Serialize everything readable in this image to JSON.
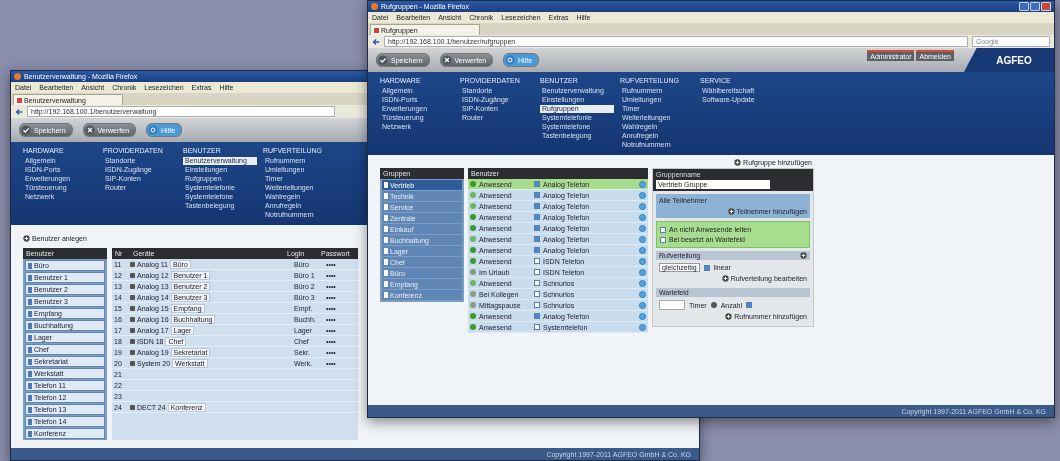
{
  "windows": [
    {
      "title": "Benutzerverwaltung - Mozilla Firefox",
      "menu": [
        "Datei",
        "Bearbeiten",
        "Ansicht",
        "Chronik",
        "Lesezeichen",
        "Extras",
        "Hilfe"
      ],
      "tab": "Benutzerverwaltung",
      "url": "http://192.168.100.1/benutzerverwaltung",
      "buttons": [
        {
          "kind": "save",
          "label": "Speichern"
        },
        {
          "kind": "discard",
          "label": "Verwerfen"
        },
        {
          "kind": "help",
          "label": "Hilfe"
        }
      ],
      "nav": [
        {
          "heading": "HARDWARE",
          "items": [
            {
              "label": "Allgemein",
              "selected": false
            },
            {
              "label": "ISDN-Ports",
              "selected": false
            },
            {
              "label": "Erweiterungen",
              "selected": false
            },
            {
              "label": "Türsteuerung",
              "selected": false
            },
            {
              "label": "Netzwerk",
              "selected": false
            }
          ]
        },
        {
          "heading": "PROVIDERDATEN",
          "items": [
            {
              "label": "Standorte",
              "selected": false
            },
            {
              "label": "ISDN-Zugänge",
              "selected": false
            },
            {
              "label": "SIP-Konten",
              "selected": false
            },
            {
              "label": "Router",
              "selected": false
            }
          ]
        },
        {
          "heading": "BENUTZER",
          "items": [
            {
              "label": "Benutzerverwaltung",
              "selected": true
            },
            {
              "label": "Einstellungen",
              "selected": false
            },
            {
              "label": "Rufgruppen",
              "selected": false
            },
            {
              "label": "Systemtelefonie",
              "selected": false
            },
            {
              "label": "Systemtelefone",
              "selected": false
            },
            {
              "label": "Tastenbelegung",
              "selected": false
            }
          ]
        },
        {
          "heading": "RUFVERTEILUNG",
          "items": [
            {
              "label": "Rufnummern",
              "selected": false
            },
            {
              "label": "Umleitungen",
              "selected": false
            },
            {
              "label": "Timer",
              "selected": false
            },
            {
              "label": "Weiterleitungen",
              "selected": false
            },
            {
              "label": "Wahlregeln",
              "selected": false
            },
            {
              "label": "Anrufregeln",
              "selected": false
            },
            {
              "label": "Notrufnummern",
              "selected": false
            }
          ]
        }
      ],
      "content": {
        "kind": "users",
        "action": "Benutzer anlegen",
        "list_title": "Benutzer",
        "list": [
          "Büro",
          "Benutzer 1",
          "Benutzer 2",
          "Benutzer 3",
          "Empfang",
          "Buchhaltung",
          "Lager",
          "Chef",
          "Sekretariat",
          "Werkstatt",
          "Telefon 11",
          "Telefon 12",
          "Telefon 13",
          "Telefon 14",
          "Konferenz"
        ],
        "columns": [
          "Nr",
          "Geräte",
          "Login",
          "Passwort"
        ],
        "rows": [
          {
            "number": "11",
            "device": "Analog 11",
            "name": "Büro",
            "login": "Büro",
            "password": "••••"
          },
          {
            "number": "12",
            "device": "Analog 12",
            "name": "Benutzer 1",
            "login": "Büro 1",
            "password": "••••"
          },
          {
            "number": "13",
            "device": "Analog 13",
            "name": "Benutzer 2",
            "login": "Büro 2",
            "password": "••••"
          },
          {
            "number": "14",
            "device": "Analog 14",
            "name": "Benutzer 3",
            "login": "Büro 3",
            "password": "••••"
          },
          {
            "number": "15",
            "device": "Analog 15",
            "name": "Empfang",
            "login": "Empf.",
            "password": "••••"
          },
          {
            "number": "16",
            "device": "Analog 16",
            "name": "Buchhaltung",
            "login": "Buchh.",
            "password": "••••"
          },
          {
            "number": "17",
            "device": "Analog 17",
            "name": "Lager",
            "login": "Lager",
            "password": "••••"
          },
          {
            "number": "18",
            "device": "ISDN 18",
            "name": "Chef",
            "login": "Chef",
            "password": "••••"
          },
          {
            "number": "19",
            "device": "Analog 19",
            "name": "Sekretariat",
            "login": "Sekr.",
            "password": "••••"
          },
          {
            "number": "20",
            "device": "System 20",
            "name": "Werkstatt",
            "login": "Werk.",
            "password": "••••"
          },
          {
            "number": "21"
          },
          {
            "number": "22"
          },
          {
            "number": "23"
          },
          {
            "number": "24",
            "device": "DECT 24",
            "name": "Konferenz"
          }
        ]
      },
      "footer": "Copyright 1997-2011 AGFEO GmbH & Co. KG"
    },
    {
      "title": "Rufgruppen - Mozilla Firefox",
      "menu": [
        "Datei",
        "Bearbeiten",
        "Ansicht",
        "Chronik",
        "Lesezeichen",
        "Extras",
        "Hilfe"
      ],
      "tab": "Rufgruppen",
      "url": "http://192.168.100.1/benutzer/rufgruppen",
      "search": "Google",
      "buttons": [
        {
          "kind": "save",
          "label": "Speichern"
        },
        {
          "kind": "discard",
          "label": "Verwerfen"
        },
        {
          "kind": "help",
          "label": "Hilfe"
        }
      ],
      "session": [
        "Administrator",
        "Abmelden"
      ],
      "logo": "AGFEO",
      "nav": [
        {
          "heading": "HARDWARE",
          "items": [
            {
              "label": "Allgemein",
              "selected": false
            },
            {
              "label": "ISDN-Ports",
              "selected": false
            },
            {
              "label": "Erweiterungen",
              "selected": false
            },
            {
              "label": "Türsteuerung",
              "selected": false
            },
            {
              "label": "Netzwerk",
              "selected": false
            }
          ]
        },
        {
          "heading": "PROVIDERDATEN",
          "items": [
            {
              "label": "Standorte",
              "selected": false
            },
            {
              "label": "ISDN-Zugänge",
              "selected": false
            },
            {
              "label": "SIP-Konten",
              "selected": false
            },
            {
              "label": "Router",
              "selected": false
            }
          ]
        },
        {
          "heading": "BENUTZER",
          "items": [
            {
              "label": "Benutzerverwaltung",
              "selected": false
            },
            {
              "label": "Einstellungen",
              "selected": false
            },
            {
              "label": "Rufgruppen",
              "selected": true
            },
            {
              "label": "Systemtelefonie",
              "selected": false
            },
            {
              "label": "Systemtelefone",
              "selected": false
            },
            {
              "label": "Tastenbelegung",
              "selected": false
            }
          ]
        },
        {
          "heading": "RUFVERTEILUNG",
          "items": [
            {
              "label": "Rufnummern",
              "selected": false
            },
            {
              "label": "Umleitungen",
              "selected": false
            },
            {
              "label": "Timer",
              "selected": false
            },
            {
              "label": "Weiterleitungen",
              "selected": false
            },
            {
              "label": "Wahlregeln",
              "selected": false
            },
            {
              "label": "Anrufregeln",
              "selected": false
            },
            {
              "label": "Notrufnummern",
              "selected": false
            }
          ]
        },
        {
          "heading": "SERVICE",
          "items": [
            {
              "label": "Wählbereitschaft",
              "selected": false
            },
            {
              "label": "Software-Update",
              "selected": false
            }
          ]
        }
      ],
      "content": {
        "kind": "groups",
        "action": "Rufgruppe hinzufügen",
        "list_title": "Gruppen",
        "groups": [
          {
            "label": "Vertrieb",
            "selected": true
          },
          {
            "label": "Technik",
            "selected": false
          },
          {
            "label": "Service",
            "selected": false
          },
          {
            "label": "Zentrale",
            "selected": false
          },
          {
            "label": "Einkauf",
            "selected": false
          },
          {
            "label": "Buchhaltung",
            "selected": false
          },
          {
            "label": "Lager",
            "selected": false
          },
          {
            "label": "Chef",
            "selected": false
          },
          {
            "label": "Büro",
            "selected": false
          },
          {
            "label": "Empfang",
            "selected": false
          },
          {
            "label": "Konferenz",
            "selected": false
          }
        ],
        "members_title": "Benutzer",
        "members": [
          {
            "kind": "present",
            "status_label": "Anwesend",
            "device": "Analog Telefon",
            "checked": true,
            "selected": true
          },
          {
            "kind": "absent",
            "status_label": "Abwesend",
            "device": "Analog Telefon",
            "checked": true,
            "selected": false
          },
          {
            "kind": "absent",
            "status_label": "Abwesend",
            "device": "Analog Telefon",
            "checked": true,
            "selected": false
          },
          {
            "kind": "present",
            "status_label": "Anwesend",
            "device": "Analog Telefon",
            "checked": true,
            "selected": false
          },
          {
            "kind": "present",
            "status_label": "Anwesend",
            "device": "Analog Telefon",
            "checked": true,
            "selected": false
          },
          {
            "kind": "absent",
            "status_label": "Abwesend",
            "device": "Analog Telefon",
            "checked": true,
            "selected": false
          },
          {
            "kind": "present",
            "status_label": "Anwesend",
            "device": "Analog Telefon",
            "checked": true,
            "selected": false
          },
          {
            "kind": "present",
            "status_label": "Anwesend",
            "device": "ISDN Telefon",
            "checked": false,
            "selected": false
          },
          {
            "kind": "away",
            "status_label": "Im Urlaub",
            "device": "ISDN Telefon",
            "checked": false,
            "selected": false
          },
          {
            "kind": "absent",
            "status_label": "Abwesend",
            "device": "Schnurlos",
            "checked": false,
            "selected": false
          },
          {
            "kind": "away",
            "status_label": "Bei Kollegen",
            "device": "Schnurlos",
            "checked": false,
            "selected": false
          },
          {
            "kind": "away",
            "status_label": "Mittagspause",
            "device": "Schnurlos",
            "checked": false,
            "selected": false
          },
          {
            "kind": "present",
            "status_label": "Anwesend",
            "device": "Analog Telefon",
            "checked": true,
            "selected": false
          },
          {
            "kind": "present",
            "status_label": "Anwesend",
            "device": "Systemtelefon",
            "checked": false,
            "selected": false
          }
        ],
        "editor": {
          "title": "Gruppenname",
          "name_value": "Vertrieb Gruppe",
          "members_label": "Alle Teilnehmer",
          "members_link": "Teilnehmer hinzufügen",
          "options": [
            {
              "label": "An nicht Anwesende leiten",
              "checked": false
            },
            {
              "label": "Bei besetzt an Wartefeld",
              "checked": false
            }
          ],
          "distribution_title": "Rufverteilung",
          "mode": "gleichzeitig",
          "mode_checked": true,
          "order_label": "linear",
          "distribution_link": "Rufverteilung bearbeiten",
          "queue_title": "Wartefeld",
          "timer_label": "Timer",
          "count_label": "Anzahl",
          "count_checked": true,
          "bottom_link": "Rufnummer hinzufügen"
        }
      },
      "footer": "Copyright 1997-2011 AGFEO GmbH & Co. KG"
    }
  ]
}
